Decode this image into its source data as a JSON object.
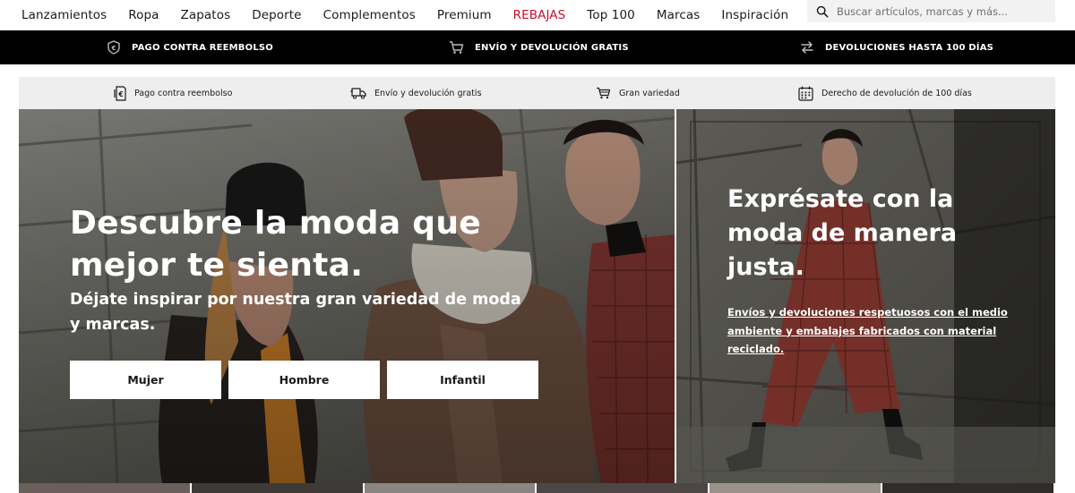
{
  "nav": {
    "items": [
      {
        "label": "Lanzamientos",
        "sale": false
      },
      {
        "label": "Ropa",
        "sale": false
      },
      {
        "label": "Zapatos",
        "sale": false
      },
      {
        "label": "Deporte",
        "sale": false
      },
      {
        "label": "Complementos",
        "sale": false
      },
      {
        "label": "Premium",
        "sale": false
      },
      {
        "label": "REBAJAS",
        "sale": true
      },
      {
        "label": "Top 100",
        "sale": false
      },
      {
        "label": "Marcas",
        "sale": false
      },
      {
        "label": "Inspiración",
        "sale": false
      }
    ],
    "search_placeholder": "Buscar artículos, marcas y más...",
    "sale_color": "#c8102e"
  },
  "blackbar": {
    "items": [
      {
        "label": "PAGO CONTRA REEMBOLSO",
        "icon": "shield-money-icon"
      },
      {
        "label": "ENVÍO Y DEVOLUCIÓN GRATIS",
        "icon": "cart-icon"
      },
      {
        "label": "DEVOLUCIONES HASTA 100 DÍAS",
        "icon": "swap-arrows-icon"
      }
    ]
  },
  "graybar": {
    "items": [
      {
        "label": "Pago contra reembolso",
        "icon": "receipt-icon"
      },
      {
        "label": "Envío y devolución gratis",
        "icon": "delivery-truck-icon"
      },
      {
        "label": "Gran variedad",
        "icon": "cart-icon"
      },
      {
        "label": "Derecho de devolución de 100 días",
        "icon": "calendar-icon"
      }
    ]
  },
  "hero_left": {
    "title": "Descubre la moda que mejor te sienta.",
    "subtitle": "Déjate inspirar por nuestra gran variedad de moda y marcas.",
    "buttons": [
      "Mujer",
      "Hombre",
      "Infantil"
    ]
  },
  "hero_right": {
    "title": "Exprésate con la moda de manera justa.",
    "link": "Envíos y devoluciones respetuosos con el medio ambiente y embalajes fabricados con material reciclado."
  }
}
